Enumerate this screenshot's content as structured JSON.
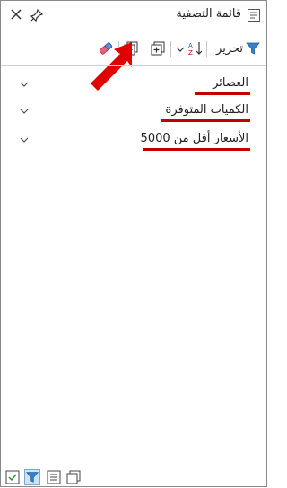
{
  "window": {
    "title": "قائمة التصفية"
  },
  "toolbar": {
    "edit_label": "تحرير",
    "icons": [
      "filter-icon",
      "sort-az-icon",
      "dropdown-icon",
      "expand-all-icon",
      "collapse-all-icon",
      "clear-filter-icon"
    ]
  },
  "filters": [
    {
      "label": "العصائر"
    },
    {
      "label": "الكميات المتوفرة"
    },
    {
      "label": "الأسعار أقل من 5000"
    }
  ],
  "colors": {
    "underline": "#c00000",
    "arrow": "#e00000",
    "active_tab": "#cfe3f7"
  },
  "bottom_tabs": [
    "checked-list-icon",
    "filter-pane-icon",
    "list-view-icon",
    "copy-icon"
  ]
}
